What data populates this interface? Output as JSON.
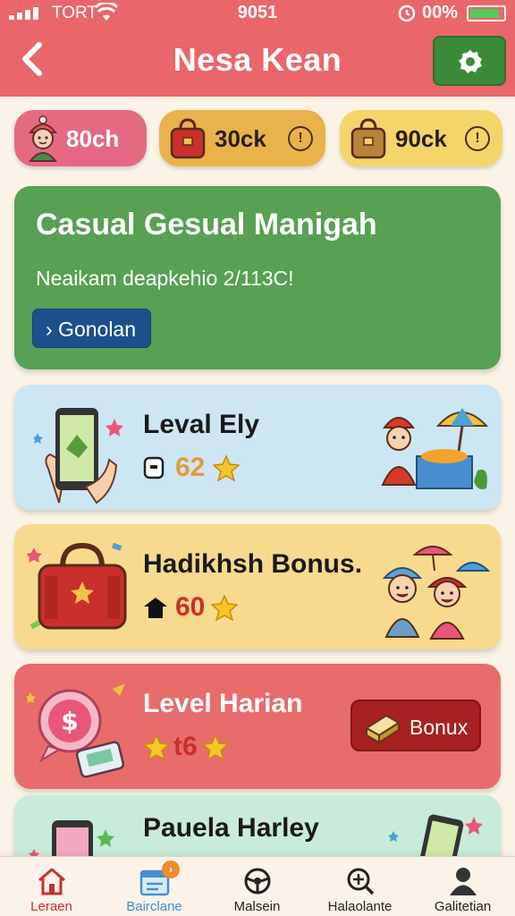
{
  "status": {
    "carrier": "TORT",
    "time": "9051",
    "battery": "00%"
  },
  "header": {
    "title": "Nesa Kean"
  },
  "currency": [
    {
      "value": "80ch"
    },
    {
      "value": "30ck",
      "info": "!"
    },
    {
      "value": "90ck",
      "info": "!"
    }
  ],
  "banner": {
    "title": "Casual Gesual Manigah",
    "subtitle": "Neaikam deapkehio 2/113C!",
    "button": "› Gonolan"
  },
  "cards": [
    {
      "title": "Leval Ely",
      "value": "62"
    },
    {
      "title": "Hadikhsh Bonus.",
      "value": "60"
    },
    {
      "title": "Level Harian",
      "value": "t6",
      "button": "Bonux"
    },
    {
      "title": "Pauela Harley"
    }
  ],
  "nav": [
    {
      "label": "Leraen"
    },
    {
      "label": "Bairclane",
      "badge": "›"
    },
    {
      "label": "Malsein"
    },
    {
      "label": "Halaolante"
    },
    {
      "label": "Galitetian"
    }
  ],
  "colors": {
    "header": "#e9676a",
    "banner": "#58a053",
    "banner_button": "#1e4f8d",
    "card_blue": "#cde6f4",
    "card_yellow": "#f7da8e",
    "card_red": "#e86c6c",
    "card_green": "#c9ebd9",
    "accent_orange": "#e49a3a",
    "accent_red": "#c9302c"
  }
}
